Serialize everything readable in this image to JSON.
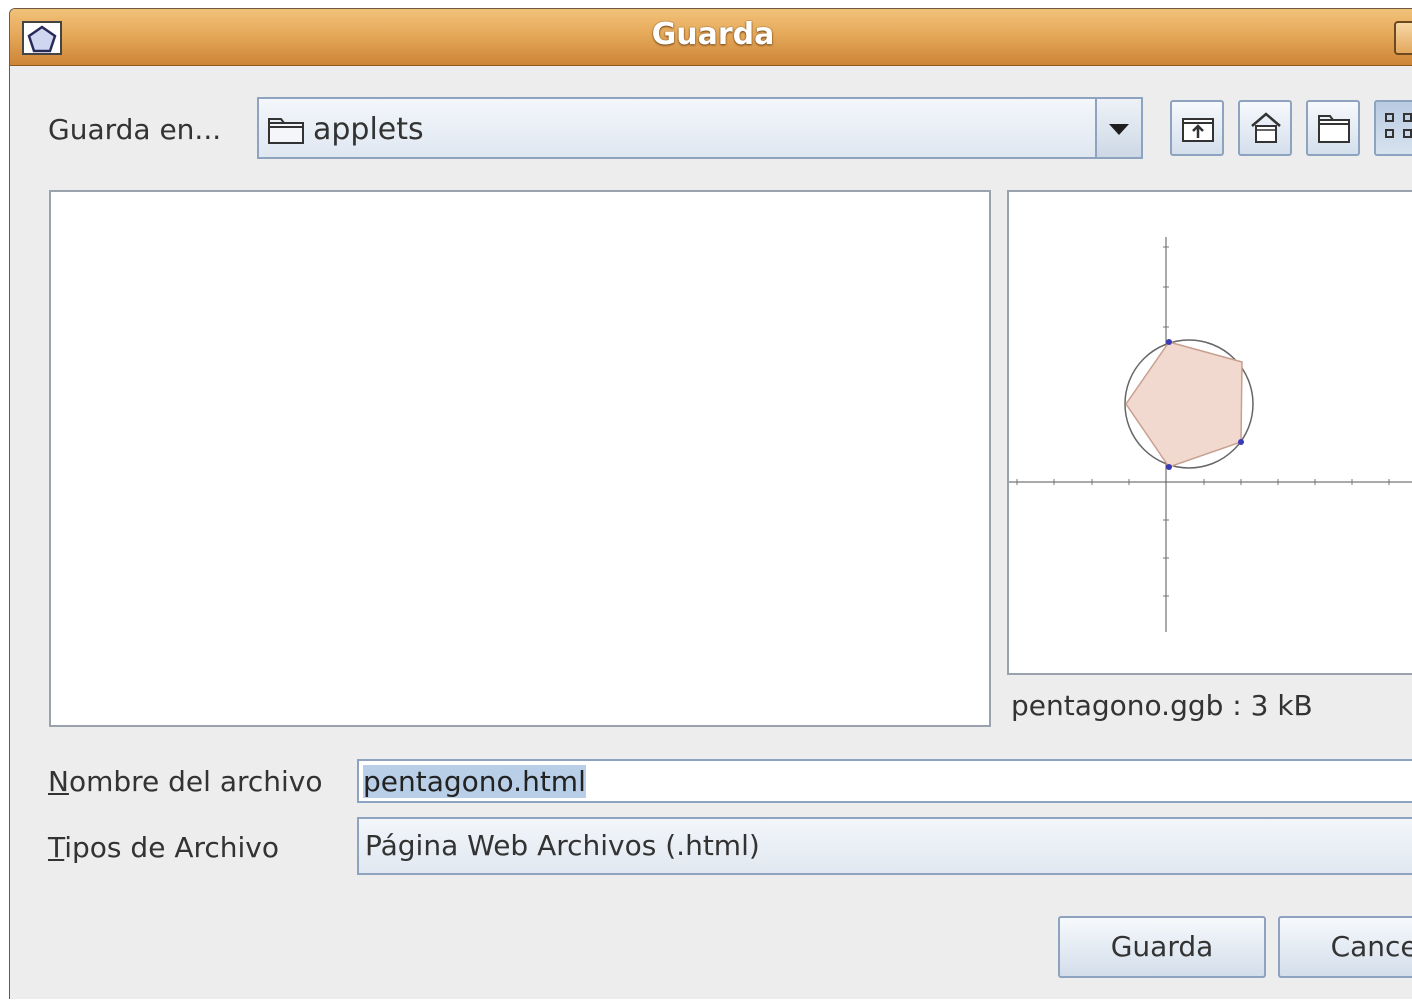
{
  "window": {
    "title": "Guarda"
  },
  "save_in": {
    "label": "Guarda en...",
    "value": "applets"
  },
  "toolbar": {
    "buttons": [
      "up-folder-icon",
      "home-icon",
      "new-folder-icon",
      "list-view-icon"
    ]
  },
  "preview": {
    "caption": "pentagono.ggb : 3 kB"
  },
  "filename": {
    "label_first": "N",
    "label_rest": "ombre del archivo",
    "value": "pentagono.html"
  },
  "filetype": {
    "label_first": "T",
    "label_rest": "ipos de Archivo",
    "value": "Página Web Archivos (.html)"
  },
  "buttons": {
    "save": "Guarda",
    "cancel": "Cancel"
  }
}
